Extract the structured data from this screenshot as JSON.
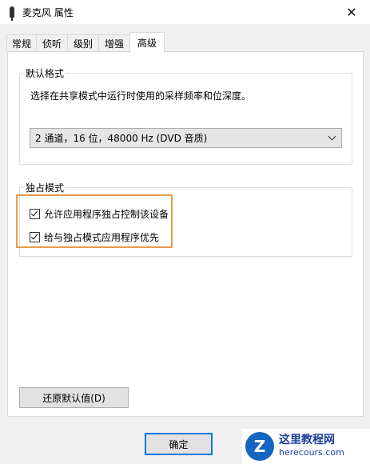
{
  "window": {
    "title": "麦克风 属性",
    "close_glyph": "✕"
  },
  "tabs": [
    {
      "label": "常规"
    },
    {
      "label": "侦听"
    },
    {
      "label": "级别"
    },
    {
      "label": "增强"
    },
    {
      "label": "高级"
    }
  ],
  "default_format": {
    "group_label": "默认格式",
    "description": "选择在共享模式中运行时使用的采样频率和位深度。",
    "selected_option": "2 通道，16 位，48000 Hz (DVD 音质)"
  },
  "exclusive_mode": {
    "group_label": "独占模式",
    "options": [
      {
        "label": "允许应用程序独占控制该设备",
        "checked": true
      },
      {
        "label": "给与独占模式应用程序优先",
        "checked": true
      }
    ]
  },
  "buttons": {
    "restore_defaults": "还原默认值(D)",
    "ok": "确定"
  },
  "watermark": {
    "logo_letter": "Z",
    "name": "这里教程网",
    "url": "herecours.com"
  },
  "colors": {
    "highlight_border": "#e89b4a",
    "focus_border": "#0078d7"
  }
}
